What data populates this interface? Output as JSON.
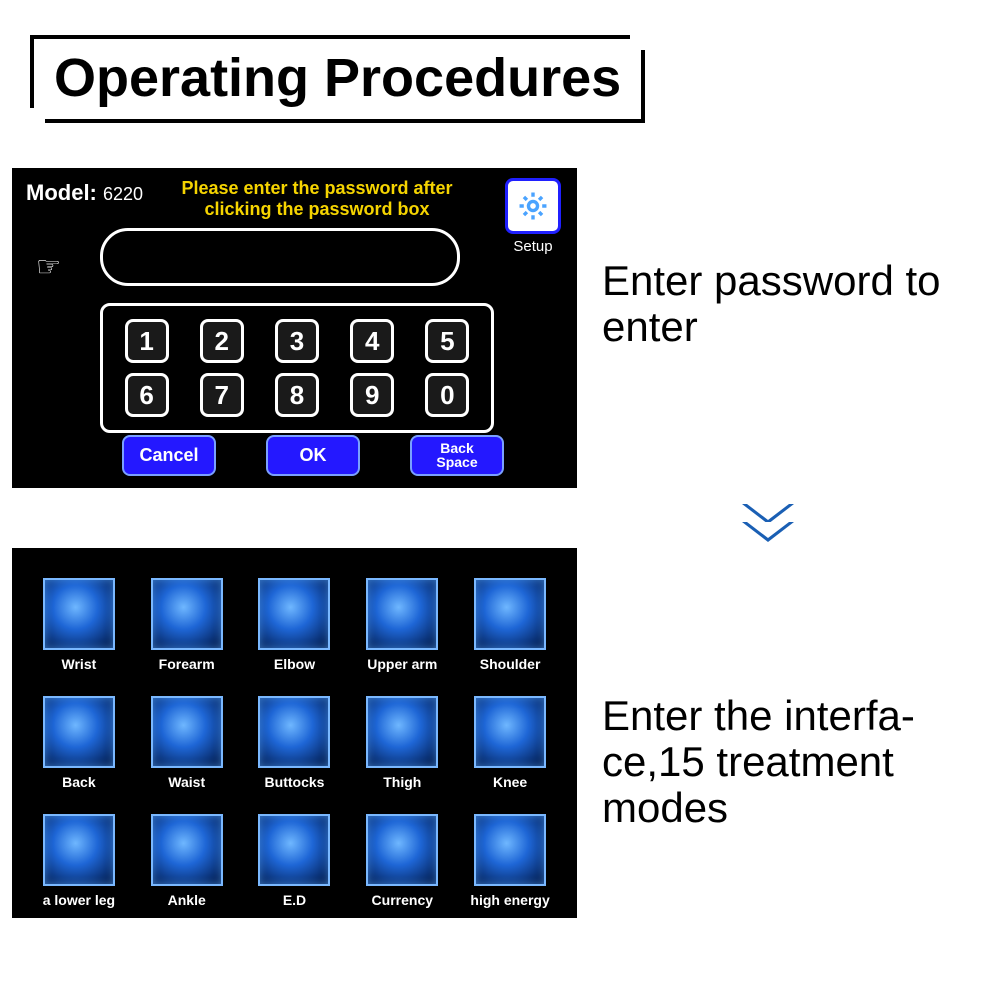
{
  "title": "Operating Procedures",
  "password_screen": {
    "model_label": "Model:",
    "model_number": "6220",
    "instruction": "Please enter the password after clicking the password box",
    "setup_label": "Setup",
    "hand_icon": "☞",
    "password_value": "",
    "keys": {
      "k1": "1",
      "k2": "2",
      "k3": "3",
      "k4": "4",
      "k5": "5",
      "k6": "6",
      "k7": "7",
      "k8": "8",
      "k9": "9",
      "k0": "0"
    },
    "cancel_label": "Cancel",
    "ok_label": "OK",
    "backspace_label": "Back\nSpace"
  },
  "side_text_1": "Enter password to enter",
  "side_text_2": "Enter the interfa-\nce,15 treatment modes",
  "modes_screen": {
    "items": [
      {
        "label": "Wrist"
      },
      {
        "label": "Forearm"
      },
      {
        "label": "Elbow"
      },
      {
        "label": "Upper arm"
      },
      {
        "label": "Shoulder"
      },
      {
        "label": "Back"
      },
      {
        "label": "Waist"
      },
      {
        "label": "Buttocks"
      },
      {
        "label": "Thigh"
      },
      {
        "label": "Knee"
      },
      {
        "label": "a lower leg"
      },
      {
        "label": "Ankle"
      },
      {
        "label": "E.D"
      },
      {
        "label": "Currency"
      },
      {
        "label": "high energy"
      }
    ]
  }
}
